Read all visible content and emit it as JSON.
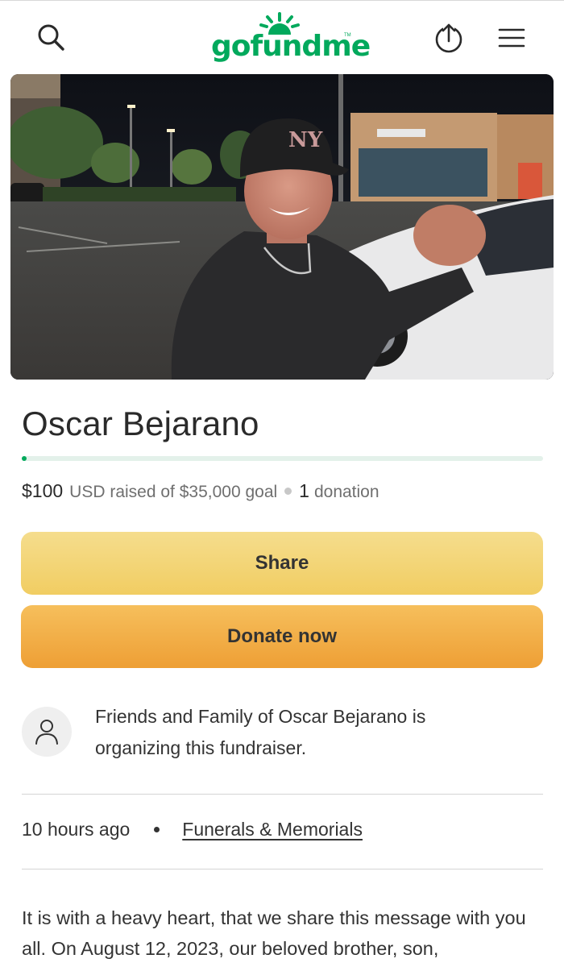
{
  "header": {
    "logo_text": "gofundme",
    "logo_tm": "TM",
    "icons": [
      "search-icon",
      "share-upload-icon",
      "menu-icon"
    ]
  },
  "colors": {
    "brand_green": "#02a95c",
    "share_button": "#f2d06a",
    "donate_button": "#f0a73e"
  },
  "campaign": {
    "title": "Oscar Bejarano",
    "raised_amount": "$100",
    "raised_label": "USD raised of $35,000 goal",
    "donation_count": "1",
    "donation_label": "donation",
    "progress_fraction": 0.003
  },
  "actions": {
    "share_label": "Share",
    "donate_label": "Donate now"
  },
  "organizer": {
    "text": "Friends and Family of Oscar Bejarano is organizing this fundraiser."
  },
  "meta": {
    "posted": "10 hours ago",
    "category": "Funerals & Memorials"
  },
  "story": {
    "text": "It is with a heavy heart, that we share this message with you all. On August 12, 2023, our beloved brother, son,"
  }
}
